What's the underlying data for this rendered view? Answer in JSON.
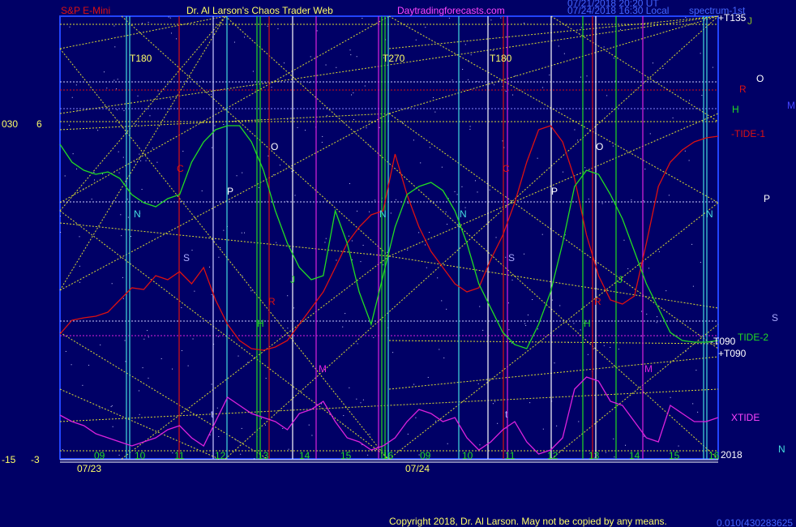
{
  "header": {
    "symbol": "S&P E-Mini",
    "site": "Dr. Al Larson's Chaos Trader Web",
    "url": "Daytradingforecasts.com",
    "stamp1": "07/21/2018 20:20 UT",
    "stamp2": "07/24/2018 16:30 Local",
    "mode": "spectrum-1st"
  },
  "left_axis": {
    "a_top": "030",
    "b_top": "6",
    "a_bottom": "-15",
    "b_bottom": "-3"
  },
  "footer": {
    "copyright": "Copyright 2018, Dr. Al Larson. May not be copied by any means.",
    "id": "0.010(430283625"
  },
  "colors": {
    "background": "#000066",
    "frame": "#2244ff",
    "text": "#ffffff",
    "red": "#dd1111",
    "green": "#22dd22",
    "magenta": "#dd22dd",
    "yellow": "#dddd33",
    "cyan": "#44dddd"
  },
  "chart_data": {
    "type": "line",
    "x_axis": {
      "hour_labels": [
        "09",
        "10",
        "11",
        "12",
        "13",
        "14",
        "15",
        "16",
        "09",
        "10",
        "11",
        "12",
        "13",
        "14",
        "15",
        "16"
      ],
      "date_labels": [
        "07/23",
        "07/24"
      ],
      "year": "2018"
    },
    "timing_labels": [
      "T180",
      "T270",
      "T180"
    ],
    "right_labels": [
      "+T135",
      "J",
      "R",
      "O",
      "H",
      "M",
      "-TIDE-1",
      "P",
      "S",
      "-T090",
      "+T090",
      "TIDE-2",
      "XTIDE",
      "N"
    ],
    "planet_marks": [
      "N",
      "S",
      "P",
      "O",
      "C",
      "R",
      "H",
      "J",
      "M",
      "t"
    ],
    "series": [
      {
        "name": "TIDE-1",
        "color": "red",
        "values": [
          412,
          395,
          392,
          390,
          385,
          370,
          355,
          357,
          340,
          345,
          335,
          350,
          330,
          370,
          400,
          420,
          430,
          432,
          428,
          420,
          400,
          380,
          360,
          330,
          300,
          280,
          265,
          260,
          190,
          240,
          280,
          310,
          330,
          350,
          360,
          355,
          320,
          290,
          250,
          200,
          160,
          155,
          175,
          220,
          290,
          340,
          370,
          375,
          365,
          300,
          230,
          200,
          185,
          175,
          170,
          168
        ]
      },
      {
        "name": "TIDE-2",
        "color": "green",
        "values": [
          178,
          200,
          210,
          215,
          212,
          220,
          240,
          250,
          255,
          245,
          240,
          200,
          175,
          160,
          155,
          155,
          175,
          210,
          260,
          300,
          330,
          345,
          340,
          260,
          300,
          360,
          400,
          340,
          280,
          240,
          230,
          225,
          235,
          260,
          300,
          350,
          380,
          410,
          425,
          430,
          400,
          360,
          300,
          230,
          210,
          215,
          240,
          270,
          310,
          350,
          380,
          410,
          420,
          422,
          422,
          420
        ]
      },
      {
        "name": "XTIDE",
        "color": "magenta",
        "values": [
          512,
          520,
          525,
          535,
          540,
          545,
          550,
          545,
          540,
          530,
          525,
          540,
          550,
          520,
          490,
          500,
          510,
          515,
          520,
          530,
          510,
          505,
          495,
          520,
          540,
          545,
          555,
          550,
          540,
          520,
          505,
          510,
          520,
          515,
          540,
          555,
          545,
          530,
          520,
          545,
          560,
          555,
          540,
          480,
          465,
          470,
          495,
          500,
          520,
          540,
          545,
          500,
          510,
          520,
          520,
          515
        ]
      }
    ]
  }
}
